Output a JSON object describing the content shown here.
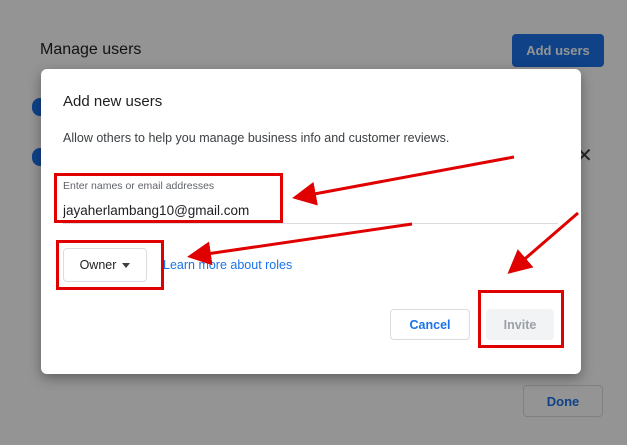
{
  "background": {
    "title": "Manage users",
    "add_users_label": "Add users",
    "close_glyph": "✕",
    "done_label": "Done"
  },
  "dialog": {
    "title": "Add new users",
    "description": "Allow others to help you manage business info and customer reviews.",
    "email_field": {
      "label": "Enter names or email addresses",
      "value": "jayaherlambang10@gmail.com"
    },
    "role": {
      "selected": "Owner"
    },
    "learn_more_link": "Learn more about roles",
    "cancel_label": "Cancel",
    "invite_label": "Invite"
  },
  "colors": {
    "accent": "#1a73e8",
    "annotation": "#e00000",
    "scrim": "rgba(0,0,0,0.42)",
    "disabled_text": "#9aa0a6"
  },
  "icons": {
    "caret": "caret-down-icon",
    "close": "close-icon"
  }
}
